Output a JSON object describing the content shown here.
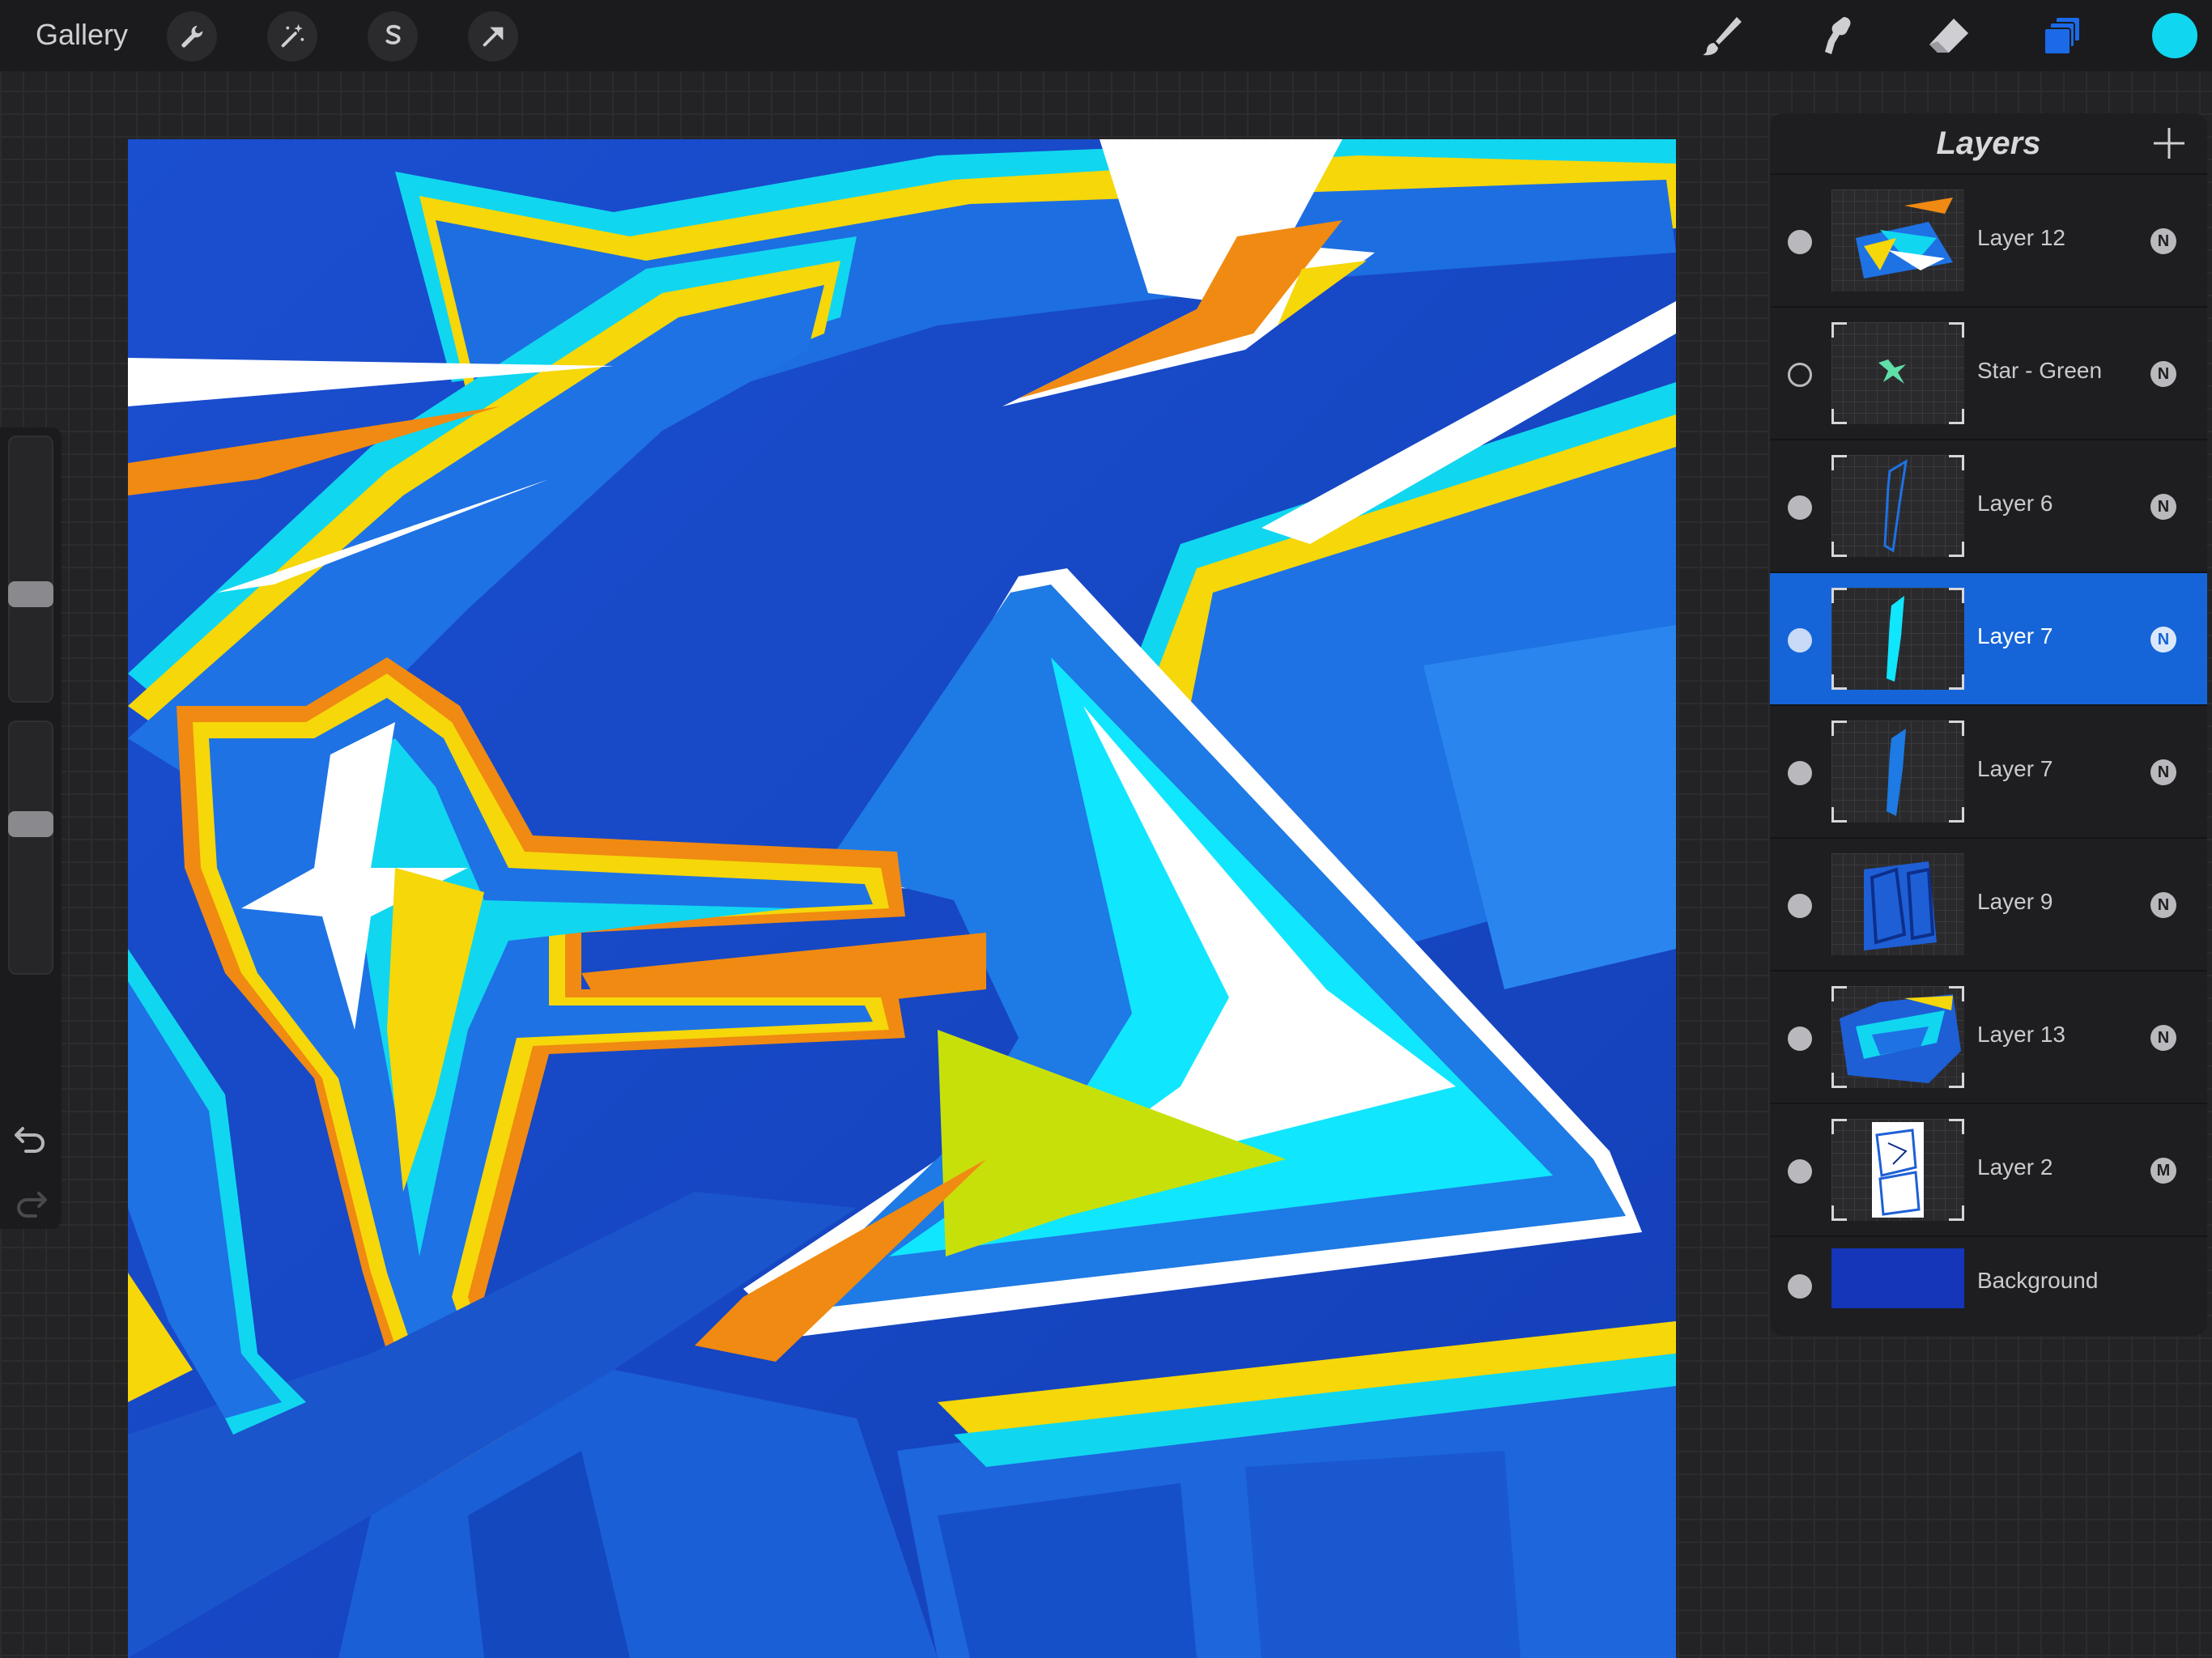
{
  "topbar": {
    "gallery_label": "Gallery",
    "left_tools": [
      {
        "icon": "wrench-icon"
      },
      {
        "icon": "magic-wand-icon"
      },
      {
        "icon": "selection-s-icon"
      },
      {
        "icon": "transform-arrow-icon"
      }
    ],
    "right_tools": [
      {
        "icon": "brush-icon"
      },
      {
        "icon": "smudge-icon"
      },
      {
        "icon": "eraser-icon"
      },
      {
        "icon": "layers-icon",
        "active": true
      }
    ],
    "current_color": "#11d6f0"
  },
  "sidebar": {
    "brush_size_icon": "slider-knob",
    "opacity_icon": "slider-knob",
    "undo_icon": "undo-icon",
    "redo_icon": "redo-icon"
  },
  "layers_panel": {
    "title": "Layers",
    "add_icon": "plus-icon",
    "layers": [
      {
        "name": "Layer 12",
        "visible": true,
        "blend": "N",
        "selected": false
      },
      {
        "name": "Star - Green",
        "visible": false,
        "blend": "N",
        "selected": false
      },
      {
        "name": "Layer 6",
        "visible": true,
        "blend": "N",
        "selected": false
      },
      {
        "name": "Layer 7",
        "visible": true,
        "blend": "N",
        "selected": true
      },
      {
        "name": "Layer 7",
        "visible": true,
        "blend": "N",
        "selected": false
      },
      {
        "name": "Layer 9",
        "visible": true,
        "blend": "N",
        "selected": false
      },
      {
        "name": "Layer 13",
        "visible": true,
        "blend": "N",
        "selected": false
      },
      {
        "name": "Layer 2",
        "visible": true,
        "blend": "M",
        "selected": false
      }
    ],
    "background": {
      "name": "Background",
      "visible": true,
      "color": "#1536b8"
    }
  },
  "colors": {
    "accent": "#1565d8",
    "canvas_blue": "#1545c4",
    "cyan": "#11d6f0",
    "yellow": "#f5d70a",
    "orange": "#f08a12"
  }
}
